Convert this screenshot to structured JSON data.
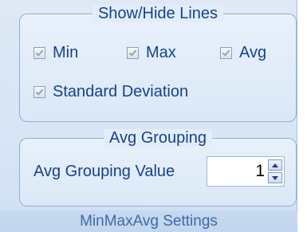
{
  "panel": {
    "caption": "MinMaxAvg Settings"
  },
  "show_hide": {
    "title": "Show/Hide Lines",
    "items": [
      {
        "label": "Min",
        "checked": true
      },
      {
        "label": "Max",
        "checked": true
      },
      {
        "label": "Avg",
        "checked": true
      },
      {
        "label": "Standard Deviation",
        "checked": true
      }
    ]
  },
  "avg_grouping": {
    "title": "Avg Grouping",
    "value_label": "Avg Grouping Value",
    "value": "1",
    "up_icon": "arrow-up-icon",
    "down_icon": "arrow-down-icon"
  },
  "colors": {
    "text": "#15428b",
    "group_border": "#8eb0d8",
    "panel_background": "#dfe9f5"
  }
}
